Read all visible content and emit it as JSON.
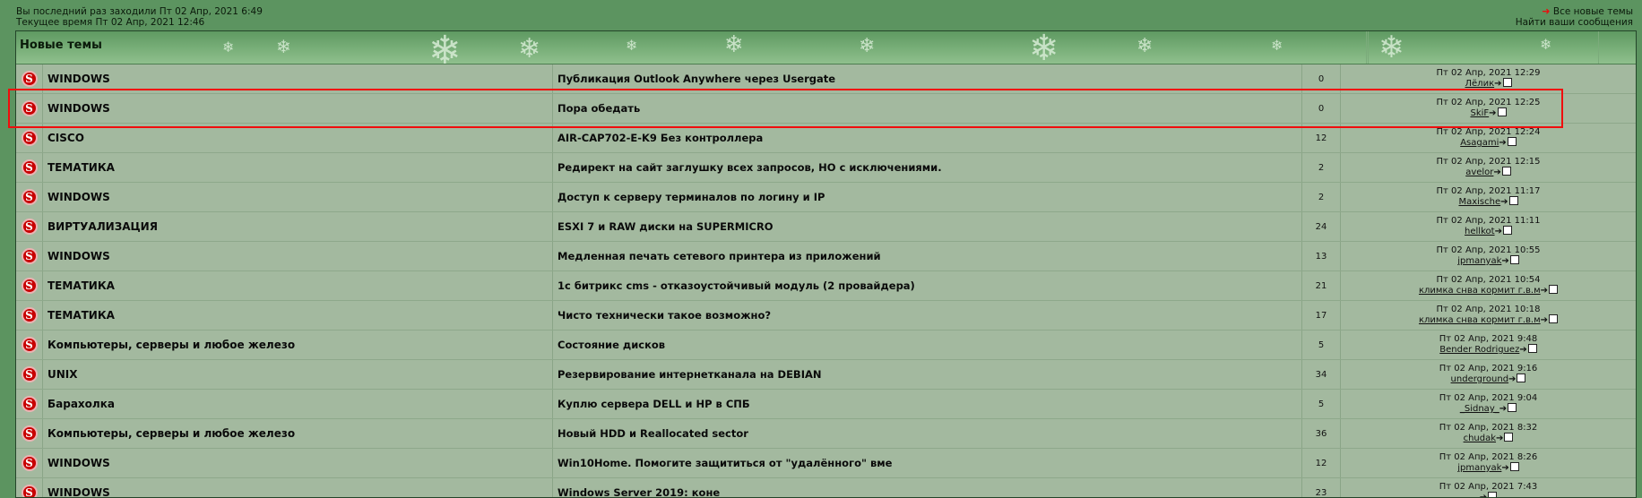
{
  "top": {
    "last_visit": "Вы последний раз заходили Пт 02 Апр, 2021 6:49",
    "current_time": "Текущее время Пт 02 Апр, 2021 12:46",
    "link_new_topics": "Все новые темы",
    "link_find_posts": "Найти ваши сообщения"
  },
  "forum": {
    "title": "Новые темы",
    "rows": [
      {
        "forum": "WINDOWS",
        "topic": "Публикация Outlook Anywhere через Usergate",
        "replies": "0",
        "date": "Пт 02 Апр, 2021 12:29",
        "author": "Лёлик"
      },
      {
        "forum": "WINDOWS",
        "topic": "Пора обедать",
        "replies": "0",
        "date": "Пт 02 Апр, 2021 12:25",
        "author": "SkiF"
      },
      {
        "forum": "CISCO",
        "topic": "AIR-CAP702-E-K9 Без контроллера",
        "replies": "12",
        "date": "Пт 02 Апр, 2021 12:24",
        "author": "Asagami"
      },
      {
        "forum": "ТЕМАТИКА",
        "topic": "Редирект на сайт заглушку всех запросов, НО с исключениями.",
        "replies": "2",
        "date": "Пт 02 Апр, 2021 12:15",
        "author": "avelor"
      },
      {
        "forum": "WINDOWS",
        "topic": "Доступ к серверу терминалов по логину и IP",
        "replies": "2",
        "date": "Пт 02 Апр, 2021 11:17",
        "author": "Maxische"
      },
      {
        "forum": "ВИРТУАЛИЗАЦИЯ",
        "topic": "ESXI 7 и RAW диски на SUPERMICRO",
        "replies": "24",
        "date": "Пт 02 Апр, 2021 11:11",
        "author": "hellkot"
      },
      {
        "forum": "WINDOWS",
        "topic": "Медленная печать сетевого принтера из приложений",
        "replies": "13",
        "date": "Пт 02 Апр, 2021 10:55",
        "author": "jpmanyak"
      },
      {
        "forum": "ТЕМАТИКА",
        "topic": "1с битрикс cms - отказоустойчивый модуль (2 провайдера)",
        "replies": "21",
        "date": "Пт 02 Апр, 2021 10:54",
        "author": "климка снва кормит г.в.м"
      },
      {
        "forum": "ТЕМАТИКА",
        "topic": "Чисто технически такое возможно?",
        "replies": "17",
        "date": "Пт 02 Апр, 2021 10:18",
        "author": "климка снва кормит г.в.м"
      },
      {
        "forum": "Компьютеры, серверы и любое железо",
        "topic": "Состояние дисков",
        "replies": "5",
        "date": "Пт 02 Апр, 2021 9:48",
        "author": "Bender Rodriguez"
      },
      {
        "forum": "UNIX",
        "topic": "Резервирование интернетканала на DEBIAN",
        "replies": "34",
        "date": "Пт 02 Апр, 2021 9:16",
        "author": "underground"
      },
      {
        "forum": "Барахолка",
        "topic": "Куплю сервера DELL и HP в СПБ",
        "replies": "5",
        "date": "Пт 02 Апр, 2021 9:04",
        "author": "_Sidnay_"
      },
      {
        "forum": "Компьютеры, серверы и любое железо",
        "topic": "Новый HDD и Reallocated sector",
        "replies": "36",
        "date": "Пт 02 Апр, 2021 8:32",
        "author": "chudak"
      },
      {
        "forum": "WINDOWS",
        "topic": "Win10Home. Помогите защититься от \"удалённого\" вме",
        "replies": "12",
        "date": "Пт 02 Апр, 2021 8:26",
        "author": "jpmanyak"
      },
      {
        "forum": "WINDOWS",
        "topic": "Windows Server 2019: коне",
        "replies": "23",
        "date": "Пт 02 Апр, 2021 7:43",
        "author": ""
      }
    ]
  },
  "colors": {
    "highlight": "#f00d0d",
    "background": "#5c9460",
    "row": "#a3b99f"
  },
  "icons": {
    "topic_icon": "read-topic-icon",
    "goto_icon": "view-latest-post-icon"
  }
}
